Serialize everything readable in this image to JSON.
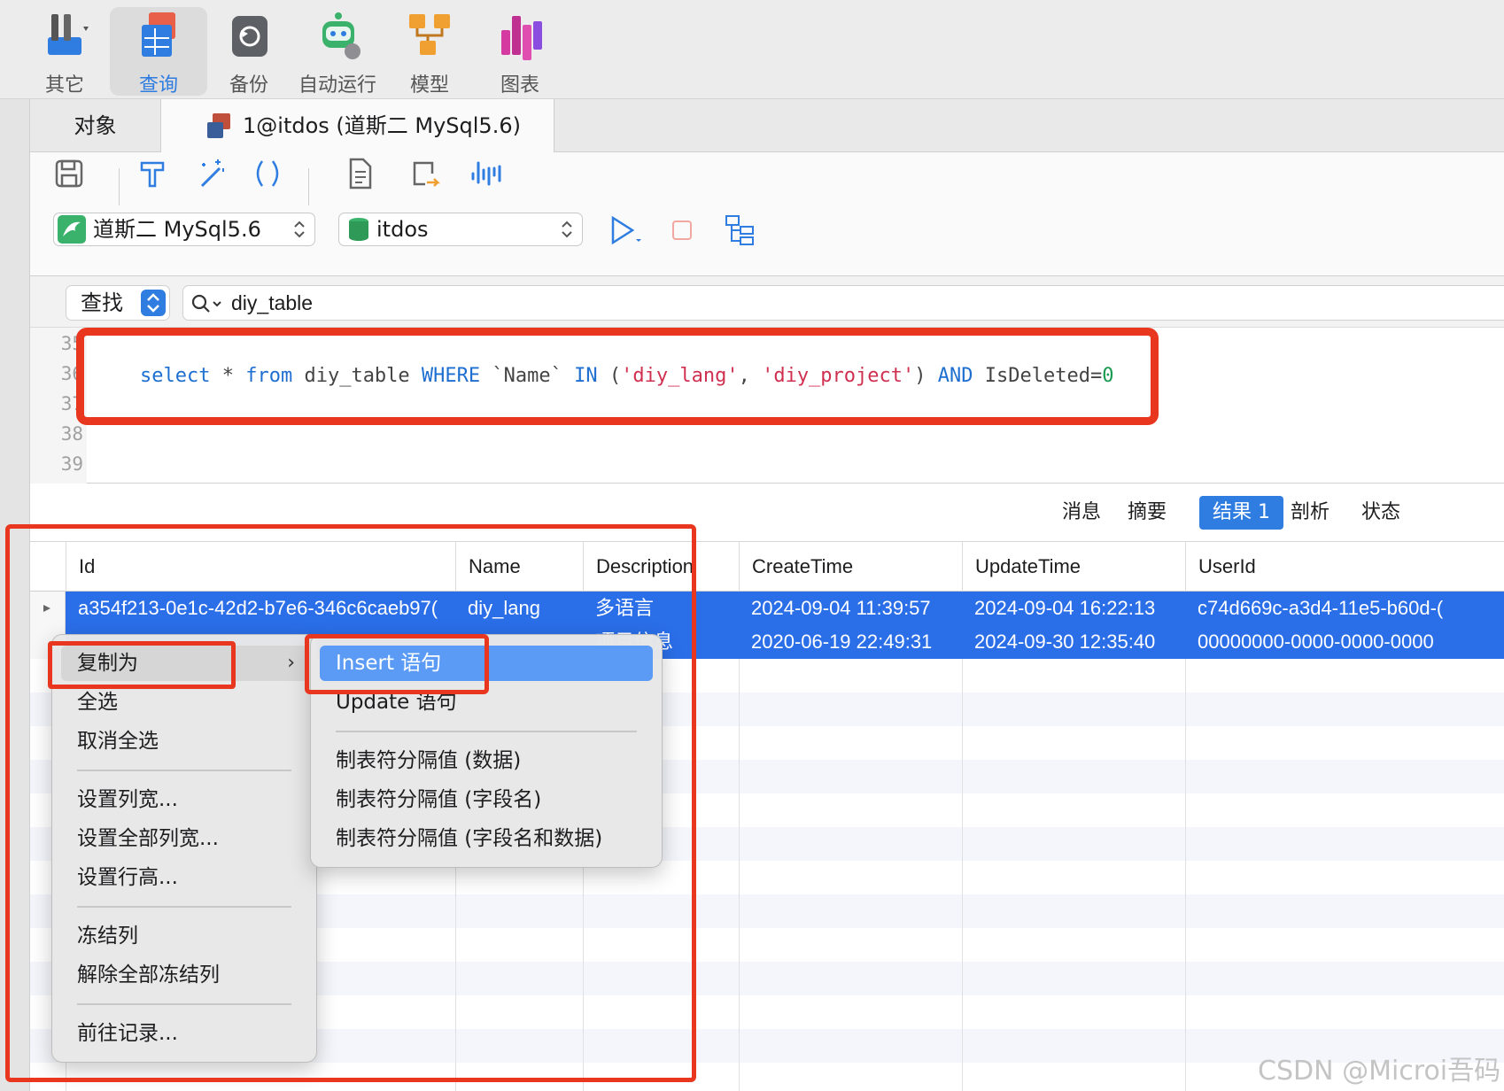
{
  "toolbar": {
    "items": [
      {
        "label": "其它",
        "icon": "tools-icon"
      },
      {
        "label": "查询",
        "icon": "query-icon",
        "active": true
      },
      {
        "label": "备份",
        "icon": "backup-icon"
      },
      {
        "label": "自动运行",
        "icon": "robot-icon"
      },
      {
        "label": "模型",
        "icon": "model-icon"
      },
      {
        "label": "图表",
        "icon": "chart-icon"
      }
    ]
  },
  "tabs": {
    "objects": "对象",
    "query": "1@itdos (道斯二 MySql5.6)"
  },
  "connection": {
    "server": "道斯二 MySql5.6",
    "database": "itdos"
  },
  "find": {
    "mode": "查找",
    "query": "diy_table"
  },
  "editor": {
    "line_numbers": [
      "35",
      "36",
      "37",
      "38",
      "39"
    ],
    "sql": {
      "select": "select",
      "star": " * ",
      "from": "from",
      "table": " diy_table ",
      "where": "WHERE",
      "col": " `Name` ",
      "in": "IN",
      "open": " (",
      "v1": "'diy_lang'",
      "comma": ", ",
      "v2": "'diy_project'",
      "close": ") ",
      "and": "AND",
      "cond": " IsDeleted=",
      "zero": "0"
    }
  },
  "result_tabs": [
    "消息",
    "摘要",
    "结果 1",
    "剖析",
    "状态"
  ],
  "grid": {
    "columns": [
      "Id",
      "Name",
      "Description",
      "CreateTime",
      "UpdateTime",
      "UserId"
    ],
    "rows": [
      [
        "a354f213-0e1c-42d2-b7e6-346c6caeb97(",
        "diy_lang",
        "多语言",
        "2024-09-04 11:39:57",
        "2024-09-04 16:22:13",
        "c74d669c-a3d4-11e5-b60d-("
      ],
      [
        "",
        "",
        "项目信息",
        "2020-06-19 22:49:31",
        "2024-09-30 12:35:40",
        "00000000-0000-0000-0000"
      ]
    ]
  },
  "context_menu": {
    "items": [
      "复制为",
      "全选",
      "取消全选",
      "设置列宽...",
      "设置全部列宽...",
      "设置行高...",
      "冻结列",
      "解除全部冻结列",
      "前往记录..."
    ]
  },
  "submenu": {
    "items": [
      "Insert 语句",
      "Update 语句",
      "制表符分隔值 (数据)",
      "制表符分隔值 (字段名)",
      "制表符分隔值 (字段名和数据)"
    ]
  },
  "watermark": "CSDN @Microi吾码",
  "colors": {
    "accent": "#2f7de1",
    "selection": "#2a6ee8",
    "annotation": "#e8361f"
  }
}
